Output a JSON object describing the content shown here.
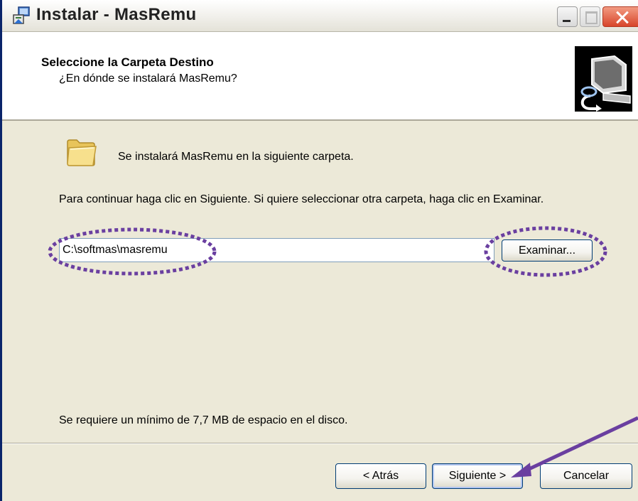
{
  "window": {
    "title": "Instalar - MasRemu"
  },
  "header": {
    "title": "Seleccione la Carpeta Destino",
    "subtitle": "¿En dónde se instalará MasRemu?"
  },
  "body": {
    "folder_text": "Se instalará MasRemu en la siguiente carpeta.",
    "instructions": "Para continuar haga clic en Siguiente. Si quiere seleccionar otra carpeta, haga clic en Examinar.",
    "path_value": "C:\\softmas\\masremu",
    "browse_label": "Examinar...",
    "space_text": "Se requiere un mínimo de 7,7 MB de espacio en el disco."
  },
  "footer": {
    "back_label": "< Atrás",
    "next_label": "Siguiente >",
    "cancel_label": "Cancelar"
  },
  "icons": {
    "app": "installer-icon",
    "folder": "folder-icon",
    "wizard": "computer-install-icon"
  },
  "annotations": {
    "color": "#6a3fa0",
    "highlights": [
      "path-input",
      "browse-button"
    ],
    "arrow_target": "next-button"
  }
}
